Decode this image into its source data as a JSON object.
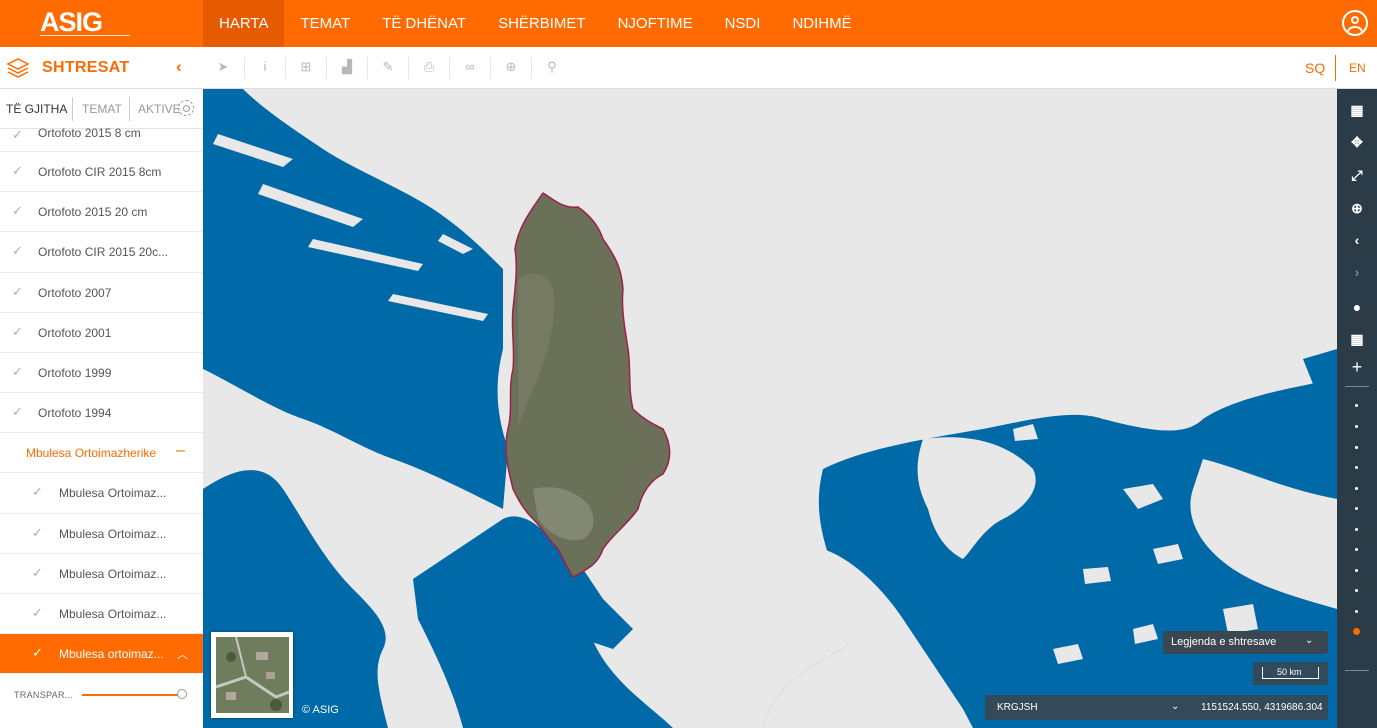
{
  "header": {
    "logo": "ASIG",
    "nav": [
      "HARTA",
      "TEMAT",
      "TË DHËNAT",
      "SHËRBIMET",
      "NJOFTIME",
      "NSDI",
      "NDIHMË"
    ],
    "active_nav": "HARTA"
  },
  "toolbar": {
    "title": "SHTRESAT",
    "collapse_icon": "chevron-left-icon",
    "tools": [
      "pointer-icon",
      "info-icon",
      "add-box-icon",
      "area-chart-icon",
      "edit-icon",
      "print-icon",
      "link-icon",
      "add-circle-icon",
      "search-icon"
    ],
    "lang_sq": "SQ",
    "lang_en": "EN"
  },
  "sidebar": {
    "tabs": [
      "TË GJITHA",
      "TEMAT",
      "AKTIVE"
    ],
    "layers": [
      "Ortofoto 2015 8 cm",
      "Ortofoto CIR 2015 8cm",
      "Ortofoto 2015 20 cm",
      "Ortofoto CIR 2015 20c...",
      "Ortofoto 2007",
      "Ortofoto 2001",
      "Ortofoto 1999",
      "Ortofoto 1994"
    ],
    "group": "Mbulesa Ortoimazherike",
    "sub_layers": [
      "Mbulesa Ortoimaz...",
      "Mbulesa Ortoimaz...",
      "Mbulesa Ortoimaz...",
      "Mbulesa Ortoimaz...",
      "Mbulesa ortoimaz..."
    ],
    "transparency_label": "TRANSPAR...",
    "transparency_value": 1.0
  },
  "map": {
    "copyright": "© ASIG",
    "legend_label": "Legjenda e shtresave",
    "scale_label": "50 km",
    "crs": "KRGJSH",
    "coordinates": "1151524.550, 4319686.304",
    "colors": {
      "sea": "#0069a8",
      "land": "#e8e8e8",
      "albania": "#6b7059",
      "border": "#a0204a"
    }
  },
  "right_toolbar": {
    "buttons": [
      "map-icon",
      "fullscreen-icon",
      "expand-icon",
      "zoom-in-icon",
      "back-icon",
      "forward-icon",
      "globe-icon",
      "grid-icon",
      "plus-icon"
    ],
    "zoom_levels": 12,
    "zoom_active": 12
  }
}
